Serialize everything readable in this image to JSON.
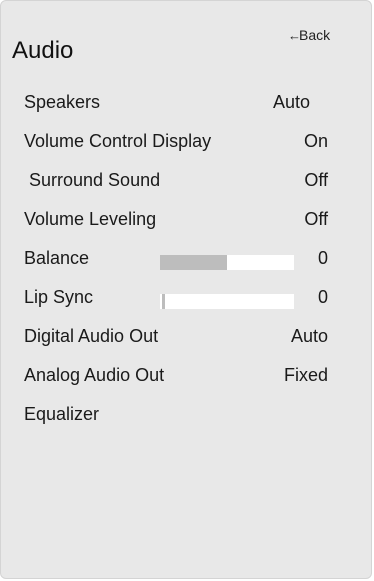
{
  "header": {
    "back_label": "Back",
    "title": "Audio"
  },
  "menu": {
    "speakers": {
      "label": "Speakers",
      "value": "Auto"
    },
    "volume_control_display": {
      "label": "Volume Control Display",
      "value": "On"
    },
    "surround_sound": {
      "label": " Surround Sound",
      "value": "Off"
    },
    "volume_leveling": {
      "label": "Volume Leveling",
      "value": "Off"
    },
    "balance": {
      "label": "Balance",
      "value": "0",
      "level_fraction": 0.5
    },
    "lip_sync": {
      "label": "Lip Sync",
      "value": "0",
      "level_fraction": 0.0
    },
    "digital_audio_out": {
      "label": "Digital Audio Out",
      "value": "Auto"
    },
    "analog_audio_out": {
      "label": "Analog Audio Out",
      "value": "Fixed"
    },
    "equalizer": {
      "label": "Equalizer"
    }
  },
  "colors": {
    "panel_background": "#e8e8e8",
    "slider_track": "#ffffff",
    "slider_fill": "#bdbdbd",
    "text": "#1a1a1a"
  },
  "icons": {
    "back": "left-arrow-icon"
  }
}
